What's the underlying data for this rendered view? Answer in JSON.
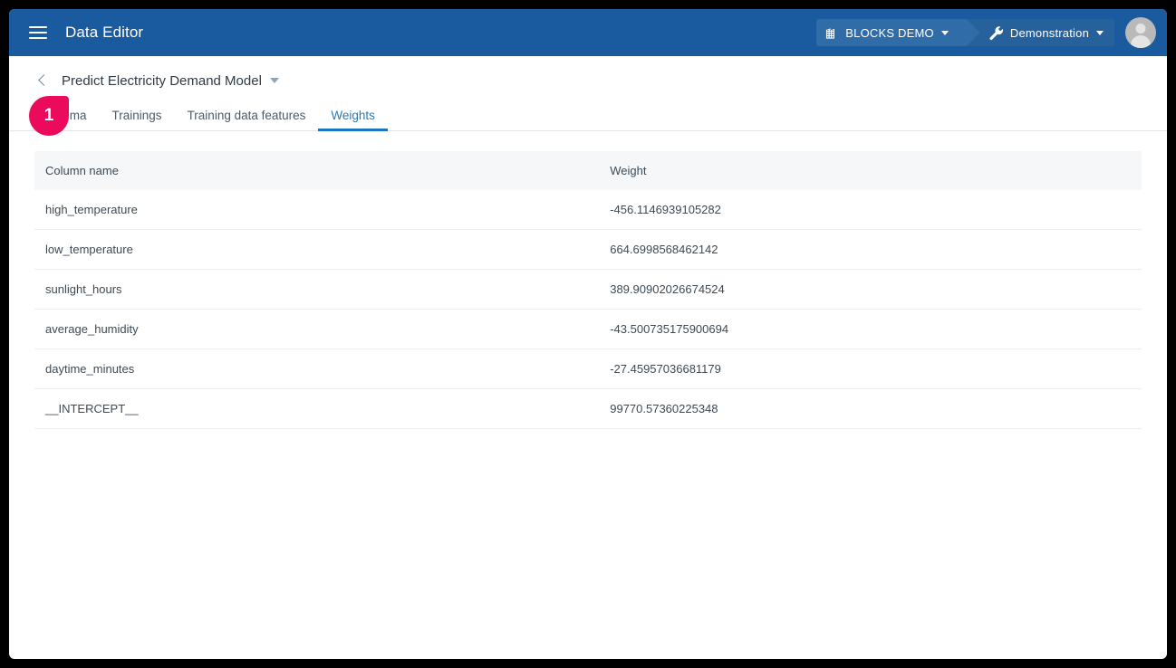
{
  "appbar": {
    "menu_icon": "hamburger-menu-icon",
    "title": "Data Editor",
    "breadcrumb": [
      {
        "icon": "building-icon",
        "label": "BLOCKS DEMO",
        "caret": "chevron-down-icon"
      },
      {
        "icon": "wrench-icon",
        "label": "Demonstration",
        "caret": "chevron-down-icon"
      }
    ],
    "avatar_icon": "user-avatar-icon",
    "bar_color": "#1a5a9e"
  },
  "page": {
    "back_icon": "chevron-left-icon",
    "title": "Predict Electricity Demand Model",
    "title_caret_icon": "triangle-down-icon"
  },
  "tabs": {
    "items": [
      {
        "label": "Schema",
        "active": false
      },
      {
        "label": "Trainings",
        "active": false
      },
      {
        "label": "Training data features",
        "active": false
      },
      {
        "label": "Weights",
        "active": true
      }
    ],
    "active_color": "#1976c4"
  },
  "marker": {
    "number": "1",
    "color": "#ec0a5c"
  },
  "table": {
    "headers": [
      "Column name",
      "Weight"
    ],
    "rows": [
      {
        "name": "high_temperature",
        "weight": "-456.1146939105282"
      },
      {
        "name": "low_temperature",
        "weight": "664.6998568462142"
      },
      {
        "name": "sunlight_hours",
        "weight": "389.90902026674524"
      },
      {
        "name": "average_humidity",
        "weight": "-43.500735175900694"
      },
      {
        "name": "daytime_minutes",
        "weight": "-27.45957036681179"
      },
      {
        "name": "__INTERCEPT__",
        "weight": "99770.57360225348"
      }
    ]
  }
}
